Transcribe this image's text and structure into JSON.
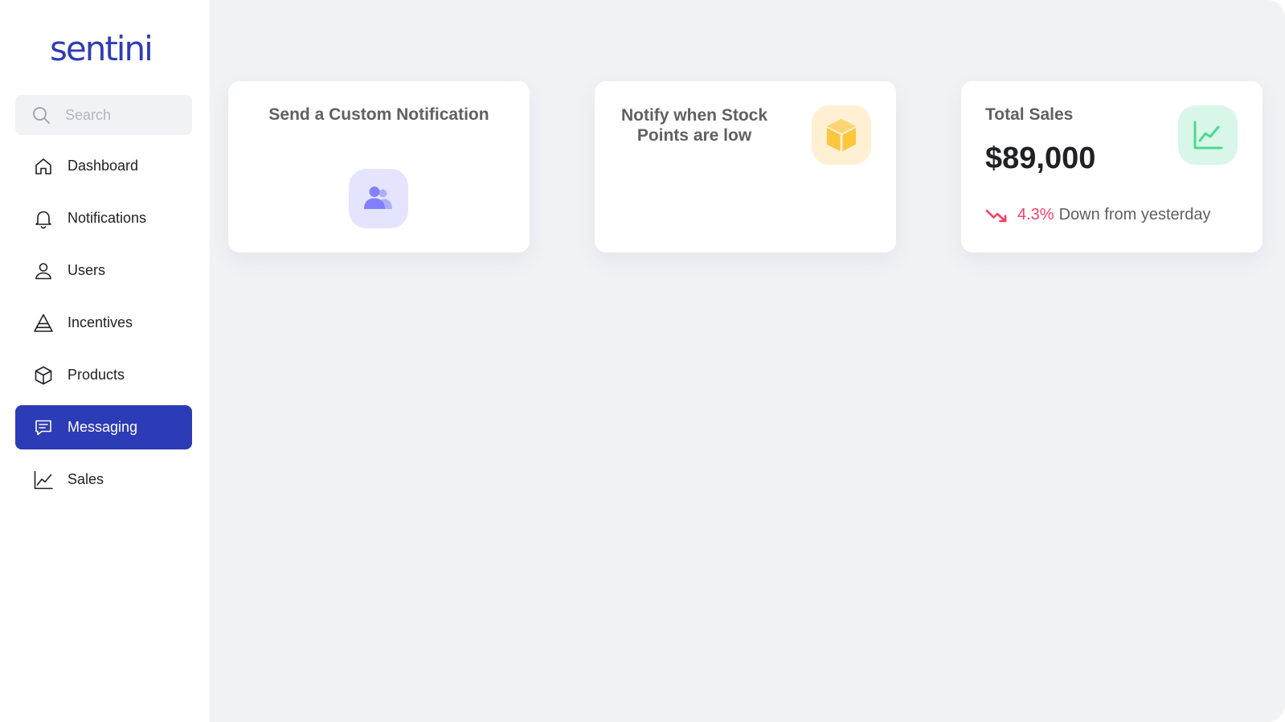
{
  "brand": {
    "logo_text": "sentini",
    "color": "#2f3cb5"
  },
  "search": {
    "placeholder": "Search",
    "icon": "search-icon"
  },
  "sidebar": {
    "items": [
      {
        "label": "Dashboard",
        "icon": "home-icon",
        "active": false
      },
      {
        "label": "Notifications",
        "icon": "bell-icon",
        "active": false
      },
      {
        "label": "Users",
        "icon": "user-icon",
        "active": false
      },
      {
        "label": "Incentives",
        "icon": "pyramid-icon",
        "active": false
      },
      {
        "label": "Products",
        "icon": "cube-icon",
        "active": false
      },
      {
        "label": "Messaging",
        "icon": "message-icon",
        "active": true
      },
      {
        "label": "Sales",
        "icon": "line-chart-icon",
        "active": false
      }
    ],
    "active_color": "#2c3bb6"
  },
  "cards": {
    "custom_notification": {
      "title": "Send a Custom Notification",
      "icon": "users-group-icon",
      "icon_color": "#8280ff",
      "tile_color": "#e5e4ff"
    },
    "stock_notify": {
      "title": "Notify when Stock Points are low",
      "icon": "box-icon",
      "icon_color": "#fec53d",
      "tile_color": "#fff0d4"
    },
    "total_sales": {
      "title": "Total Sales",
      "value": "$89,000",
      "change": "4.3%",
      "change_text": "Down from yesterday",
      "trend": "down",
      "trend_color": "#f93c65",
      "icon": "chart-icon",
      "icon_color": "#4ad991",
      "tile_color": "#d9f7e8"
    }
  }
}
